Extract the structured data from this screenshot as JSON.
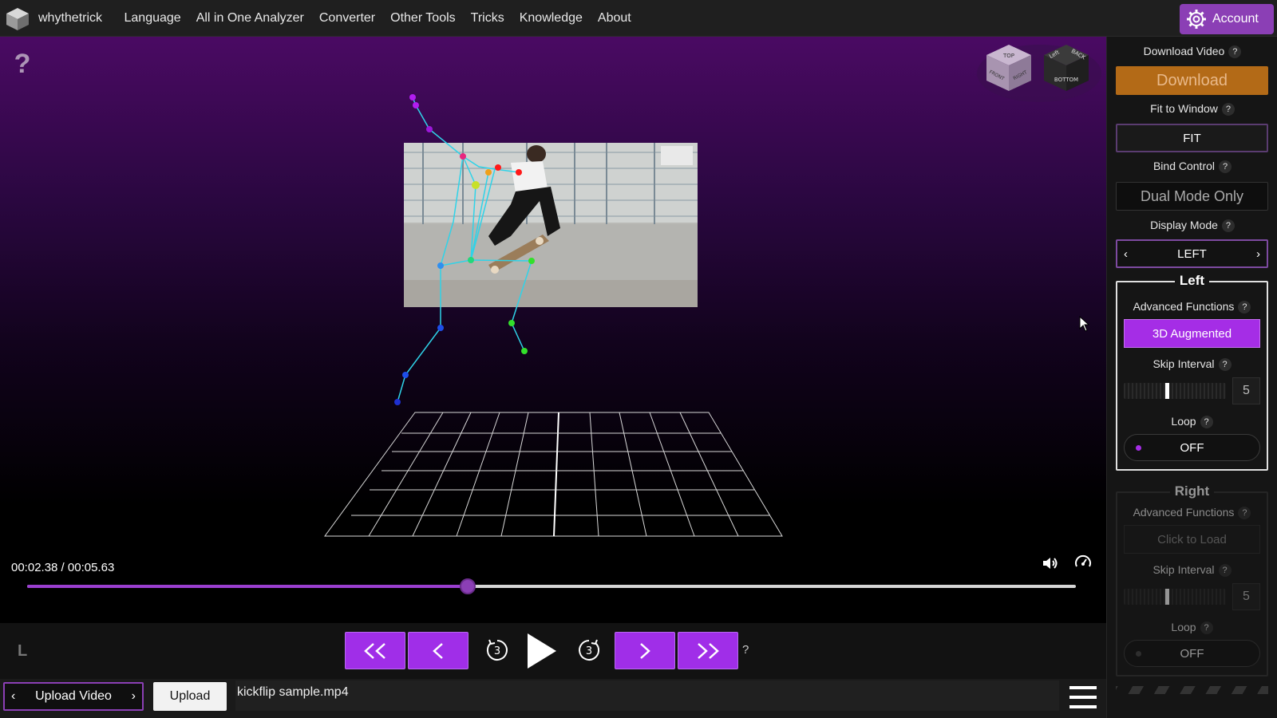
{
  "brand": {
    "name": "whythetrick",
    "logo_icon": "cube-logo-icon"
  },
  "nav": {
    "items": [
      "Language",
      "All in One Analyzer",
      "Converter",
      "Other Tools",
      "Tricks",
      "Knowledge",
      "About"
    ]
  },
  "account": {
    "label": "Account",
    "icon": "gear-icon"
  },
  "viewer": {
    "help": "?",
    "viewcube": {
      "top": "TOP",
      "front": "FRONT",
      "right": "RIGHT",
      "left": "Left",
      "back": "BACK",
      "bottom": "BOTTOM"
    },
    "time": "00:02.38 / 00:05.63",
    "progress_fraction": 0.42
  },
  "playback": {
    "lr_label": "L",
    "rewind_fast": "<<",
    "step_back": "<",
    "skip_back_seconds": "3",
    "skip_forward_seconds": "3",
    "step_forward": ">",
    "forward_fast": ">>",
    "help": "?"
  },
  "bottom": {
    "upload_select": "Upload Video",
    "upload_button": "Upload",
    "filename": "kickflip sample.mp4"
  },
  "panel": {
    "download_video_label": "Download Video",
    "download_button": "Download",
    "fit_label": "Fit to Window",
    "fit_button": "FIT",
    "bind_label": "Bind Control",
    "bind_button": "Dual Mode Only",
    "display_mode_label": "Display Mode",
    "display_mode_value": "LEFT",
    "help": "?",
    "left": {
      "title": "Left",
      "advanced_label": "Advanced Functions",
      "advanced_button": "3D Augmented",
      "skip_label": "Skip Interval",
      "skip_value": "5",
      "skip_fraction": 0.42,
      "loop_label": "Loop",
      "loop_value": "OFF"
    },
    "right": {
      "title": "Right",
      "advanced_label": "Advanced Functions",
      "advanced_button": "Click to Load",
      "skip_label": "Skip Interval",
      "skip_value": "5",
      "skip_fraction": 0.42,
      "loop_label": "Loop",
      "loop_value": "OFF"
    }
  },
  "colors": {
    "accent": "#a02ee8",
    "download": "#b36a17",
    "skeleton": "#2fd3e8"
  }
}
